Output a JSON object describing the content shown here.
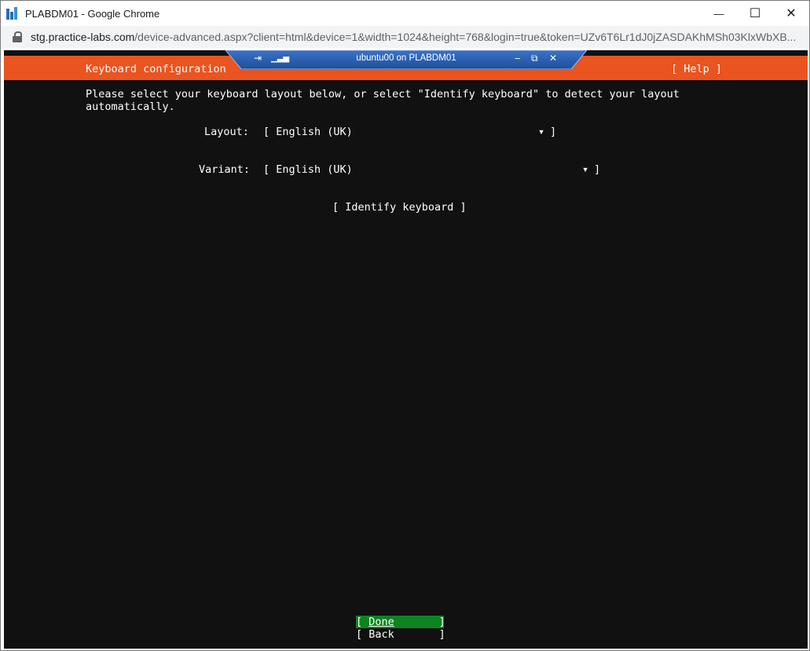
{
  "window": {
    "title": "PLABDM01 - Google Chrome",
    "minimize_glyph": "—",
    "maximize_glyph": "☐",
    "close_glyph": "✕"
  },
  "addressbar": {
    "host": "stg.practice-labs.com",
    "path": "/device-advanced.aspx?client=html&device=1&width=1024&height=768&login=true&token=UZv6T6Lr1dJ0jZASDAKhMSh03KlxWbXB..."
  },
  "connection_bar": {
    "title": "ubuntu00 on PLABDM01",
    "pin_icon": "pin-icon",
    "signal_icon": "signal-icon",
    "minimize_glyph": "‒",
    "restore_glyph": "⧉",
    "close_glyph": "✕"
  },
  "installer": {
    "header_title": "Keyboard configuration",
    "help_label": "[ Help ]",
    "intro_line1": "Please select your keyboard layout below, or select \"Identify keyboard\" to detect your layout",
    "intro_line2": "automatically.",
    "layout_label": "Layout:",
    "layout_value": "[ English (UK)",
    "variant_label": "Variant:",
    "variant_value": "[ English (UK)",
    "dropdown_arrow": "▾",
    "dropdown_close": "]",
    "identify_label": "[ Identify keyboard ]",
    "done_open": "[ ",
    "done_label": "Done",
    "done_close": "       ]",
    "back_label": "[ Back       ]",
    "accent_color": "#e95420",
    "done_color": "#0e8420"
  }
}
